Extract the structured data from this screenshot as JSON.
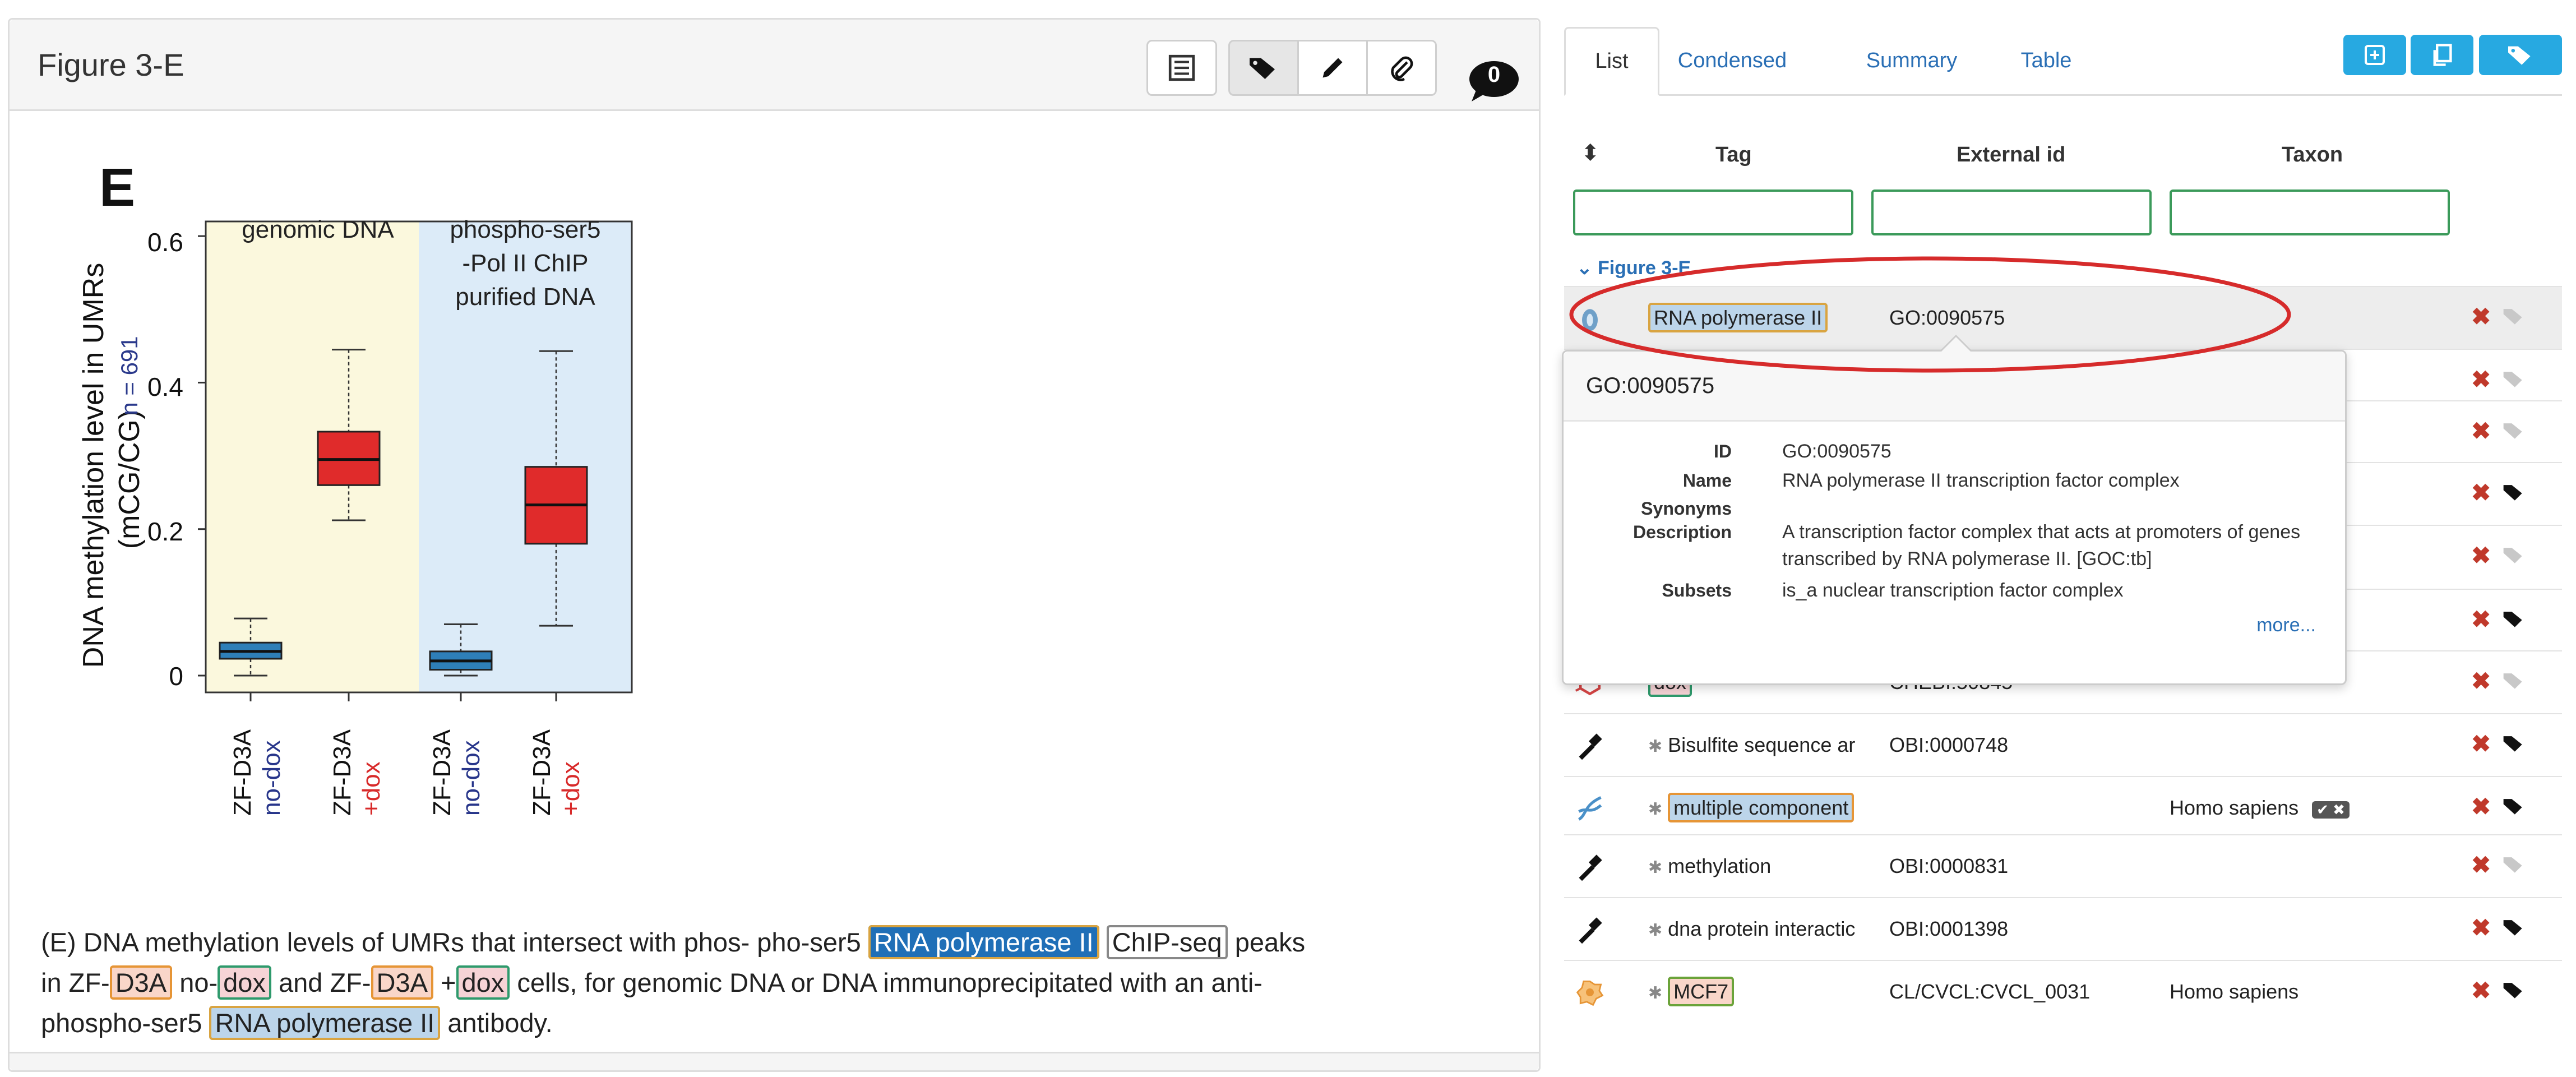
{
  "left_panel": {
    "title": "Figure 3-E",
    "comment_count": "0"
  },
  "figure": {
    "panel_letter": "E",
    "ylabel_line1": "DNA methylation level in UMRs",
    "ylabel_line2": "(mCG/CG)",
    "n_label": "n = 691",
    "yticks": [
      "0.6",
      "0.4",
      "0.2",
      "0"
    ],
    "region_labels": {
      "genomic": "genomic DNA",
      "chip_line1": "phospho-ser5",
      "chip_line2": "-Pol II ChIP",
      "chip_line3": "purified DNA"
    },
    "x_labels": [
      {
        "line1": "ZF-D3A",
        "line2": "no-dox"
      },
      {
        "line1": "ZF-D3A",
        "line2": "+dox"
      },
      {
        "line1": "ZF-D3A",
        "line2": "no-dox"
      },
      {
        "line1": "ZF-D3A",
        "line2": "+dox"
      }
    ]
  },
  "chart_data": {
    "type": "boxplot",
    "title": "",
    "ylabel": "DNA methylation level in UMRs (mCG/CG)",
    "ylim": [
      0,
      0.65
    ],
    "grid": false,
    "categories": [
      "ZF-D3A no-dox",
      "ZF-D3A +dox",
      "ZF-D3A no-dox",
      "ZF-D3A +dox"
    ],
    "groups": [
      "genomic DNA",
      "genomic DNA",
      "phospho-ser5-Pol II ChIP purified DNA",
      "phospho-ser5-Pol II ChIP purified DNA"
    ],
    "boxes": [
      {
        "whisker_low": 0.0,
        "q1": 0.023,
        "median": 0.033,
        "q3": 0.045,
        "whisker_high": 0.078
      },
      {
        "whisker_low": 0.212,
        "q1": 0.26,
        "median": 0.295,
        "q3": 0.333,
        "whisker_high": 0.445
      },
      {
        "whisker_low": 0.0,
        "q1": 0.008,
        "median": 0.02,
        "q3": 0.033,
        "whisker_high": 0.07
      },
      {
        "whisker_low": 0.068,
        "q1": 0.18,
        "median": 0.233,
        "q3": 0.285,
        "whisker_high": 0.443
      }
    ],
    "colors": {
      "no_dox": "#2e7fb8",
      "plus_dox": "#e02b2b",
      "genomic_bg": "#fbf8dd",
      "chip_bg": "#dcebf8"
    }
  },
  "caption": {
    "p1": "(E) DNA methylation levels of UMRs that intersect with phos- pho-ser5",
    "t1": "RNA polymerase II",
    "t2": "ChIP-seq",
    "p2": "peaks",
    "p3": "in ZF-",
    "t3": "D3A",
    "p4": "no-",
    "t4": "dox",
    "p5": "and ZF-",
    "t5": "D3A",
    "p6": "+",
    "t6": "dox",
    "p7": "cells, for genomic DNA or DNA immunoprecipitated with an anti-",
    "p8": "phospho-ser5",
    "t7": "RNA polymerase II",
    "p9": "antibody."
  },
  "right_panel": {
    "tabs": [
      "List",
      "Condensed",
      "Summary",
      "Table"
    ],
    "active_tab": "List",
    "columns": {
      "tag": "Tag",
      "external_id": "External id",
      "taxon": "Taxon"
    },
    "group_title": "Figure 3-E",
    "rows": [
      {
        "tag": "RNA polymerase II",
        "ext": "GO:0090575",
        "taxon": "",
        "icon": "go-term-icon",
        "star": false
      },
      {
        "tag": "",
        "ext": "",
        "taxon": "",
        "icon": "",
        "star": false
      },
      {
        "tag": "",
        "ext": "",
        "taxon": "",
        "icon": "",
        "star": false
      },
      {
        "tag": "",
        "ext": "",
        "taxon": "",
        "icon": "",
        "star": false
      },
      {
        "tag": "",
        "ext": "",
        "taxon": "",
        "icon": "",
        "star": false
      },
      {
        "tag": "",
        "ext": "",
        "taxon": "",
        "icon": "",
        "star": false
      },
      {
        "tag": "dox",
        "ext": "CHEBI:50845",
        "taxon": "",
        "icon": "chemical-icon",
        "star": false
      },
      {
        "tag": "Bisulfite sequence ar",
        "ext": "OBI:0000748",
        "taxon": "",
        "icon": "pipette-icon",
        "star": true
      },
      {
        "tag": "multiple component",
        "ext": "",
        "taxon": "Homo sapiens",
        "icon": "dna-icon",
        "star": true
      },
      {
        "tag": "methylation",
        "ext": "OBI:0000831",
        "taxon": "",
        "icon": "pipette-icon",
        "star": true
      },
      {
        "tag": "dna protein interactic",
        "ext": "OBI:0001398",
        "taxon": "",
        "icon": "pipette-icon",
        "star": true
      },
      {
        "tag": "MCF7",
        "ext": "CL/CVCL:CVCL_0031",
        "taxon": "Homo sapiens",
        "icon": "cell-line-icon",
        "star": true
      }
    ],
    "remove_symbol": "✖",
    "star_symbol": "✱"
  },
  "popover": {
    "header": "GO:0090575",
    "fields": [
      {
        "key": "ID",
        "value": "GO:0090575"
      },
      {
        "key": "Name",
        "value": "RNA polymerase II transcription factor complex"
      },
      {
        "key": "Synonyms",
        "value": ""
      },
      {
        "key": "Description",
        "value": "A transcription factor complex that acts at promoters of genes transcribed by RNA polymerase II. [GOC:tb]"
      },
      {
        "key": "Subsets",
        "value": "is_a nuclear transcription factor complex"
      }
    ],
    "more": "more..."
  }
}
